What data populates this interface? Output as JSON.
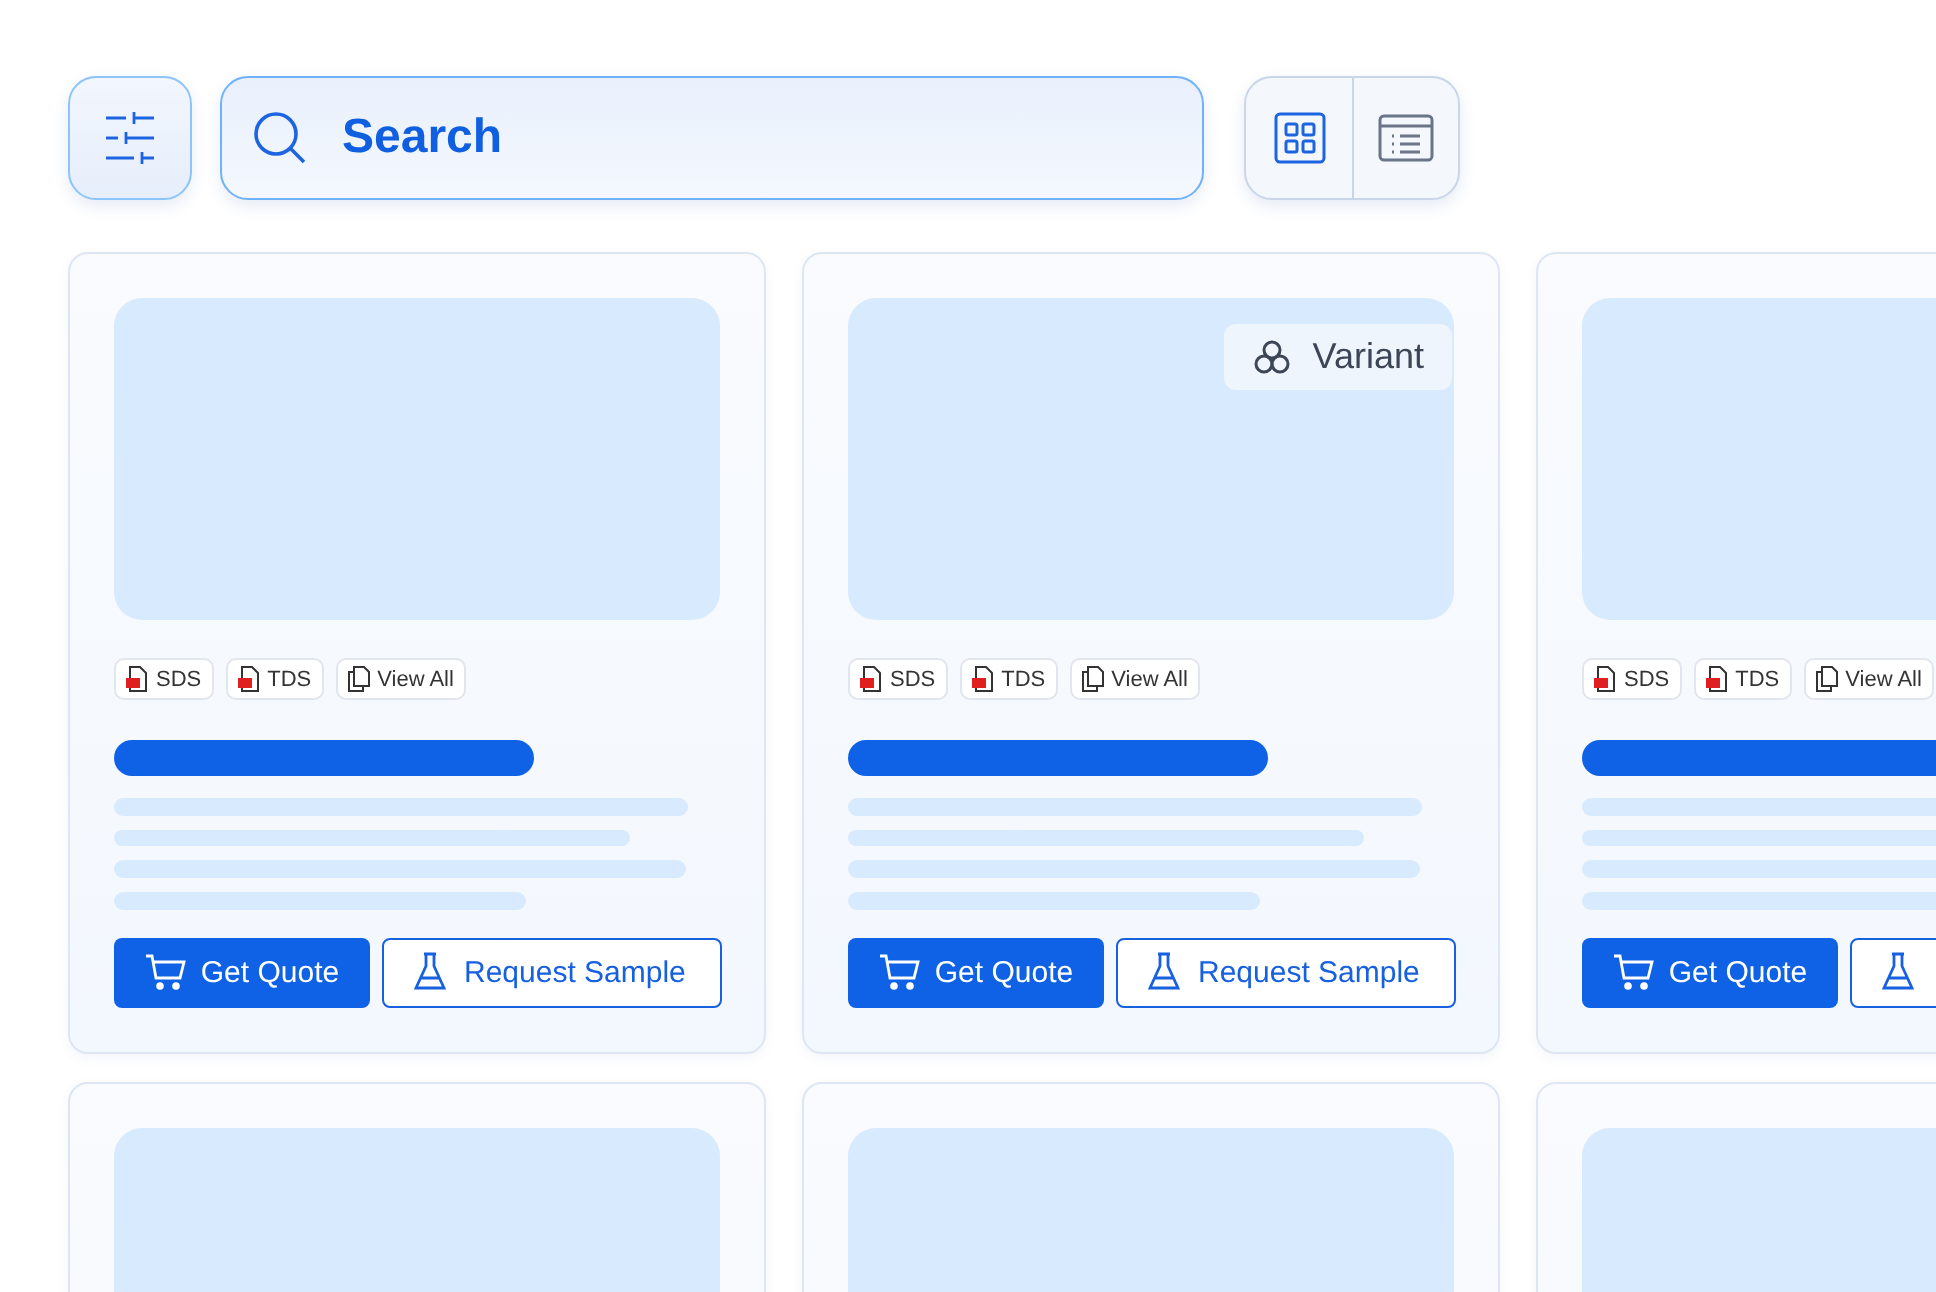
{
  "toolbar": {
    "search": {
      "placeholder": "Search"
    },
    "views": [
      {
        "kind": "grid",
        "selected": true
      },
      {
        "kind": "list",
        "selected": false
      }
    ]
  },
  "cards": [
    {
      "kind": "product",
      "docs": [
        {
          "kind": "pdf",
          "label": "SDS"
        },
        {
          "kind": "pdf",
          "label": "TDS"
        },
        {
          "kind": "all",
          "label": "View All"
        }
      ],
      "buttons": [
        {
          "kind": "quote",
          "label": "Get Quote"
        },
        {
          "kind": "sample",
          "label": "Request Sample"
        }
      ]
    },
    {
      "kind": "product",
      "badge": "Variant",
      "docs": [
        {
          "kind": "pdf",
          "label": "SDS"
        },
        {
          "kind": "pdf",
          "label": "TDS"
        },
        {
          "kind": "all",
          "label": "View All"
        }
      ],
      "buttons": [
        {
          "kind": "quote",
          "label": "Get Quote"
        },
        {
          "kind": "sample",
          "label": "Request Sample"
        }
      ]
    },
    {
      "kind": "product",
      "docs": [
        {
          "kind": "pdf",
          "label": "SDS"
        },
        {
          "kind": "pdf",
          "label": "TDS"
        },
        {
          "kind": "all",
          "label": "View All"
        }
      ],
      "buttons": [
        {
          "kind": "quote",
          "label": "Get Quote"
        },
        {
          "kind": "sample"
        }
      ]
    },
    {
      "kind": "loading"
    },
    {
      "kind": "loading"
    },
    {
      "kind": "loading"
    }
  ]
}
